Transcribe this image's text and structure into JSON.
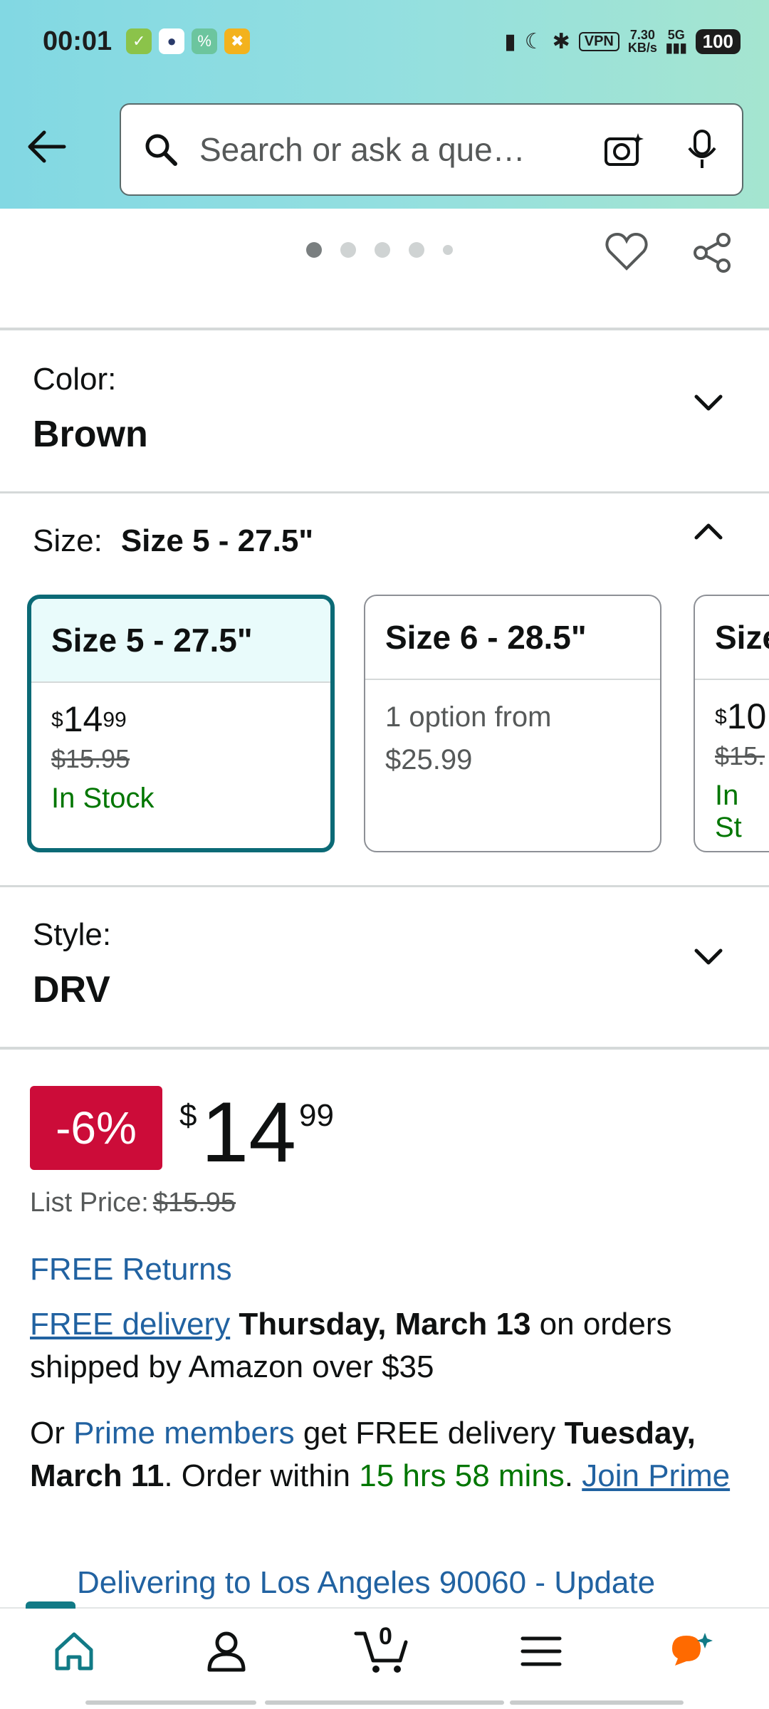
{
  "status_bar": {
    "time": "00:01",
    "vpn": "VPN",
    "speed_value": "7.30",
    "speed_unit": "KB/s",
    "network": "5G",
    "battery": "100"
  },
  "search": {
    "placeholder": "Search or ask a que…"
  },
  "carousel": {
    "dot_count": 5,
    "active_index": 0
  },
  "color": {
    "label": "Color:",
    "value": "Brown"
  },
  "size": {
    "label": "Size:",
    "selected": "Size 5 - 27.5\"",
    "cards": [
      {
        "title": "Size 5 - 27.5\"",
        "price_dollars": "14",
        "price_cents": "99",
        "list_price": "$15.95",
        "availability": "In Stock",
        "selected": true
      },
      {
        "title": "Size 6 - 28.5\"",
        "option_text": "1 option from",
        "option_price": "$25.99",
        "selected": false
      },
      {
        "title": "Size",
        "price_dollars": "10",
        "price_cents": "",
        "list_price": "$15.",
        "availability": "In St",
        "selected": false
      }
    ]
  },
  "style": {
    "label": "Style:",
    "value": "DRV"
  },
  "price": {
    "discount": "-6%",
    "currency": "$",
    "dollars": "14",
    "cents": "99",
    "list_price_label": "List Price:",
    "list_price": "$15.95"
  },
  "shipping": {
    "free_returns": "FREE Returns",
    "free_delivery": "FREE delivery",
    "delivery_date": "Thursday, March 13",
    "delivery_rest": " on orders shipped by Amazon over $35",
    "prime_prefix": "Or ",
    "prime_members": "Prime members",
    "prime_mid": " get FREE delivery ",
    "prime_date": "Tuesday, March 11",
    "prime_order": ". Order within ",
    "prime_time": "15 hrs 58 mins",
    "prime_dot": ". ",
    "join_prime": "Join Prime"
  },
  "deliver_to": "Delivering to Los Angeles 90060 - Update",
  "nav": {
    "cart_count": "0"
  },
  "colors": {
    "teal": "#0b6a76",
    "red": "#cc0c39",
    "link": "#2162a1",
    "green": "#007600"
  },
  "icons": [
    "back-arrow-icon",
    "search-icon",
    "camera-icon",
    "mic-icon",
    "heart-icon",
    "share-icon",
    "chevron-down-icon",
    "chevron-up-icon",
    "home-icon",
    "account-icon",
    "cart-icon",
    "menu-icon",
    "rufus-icon"
  ]
}
